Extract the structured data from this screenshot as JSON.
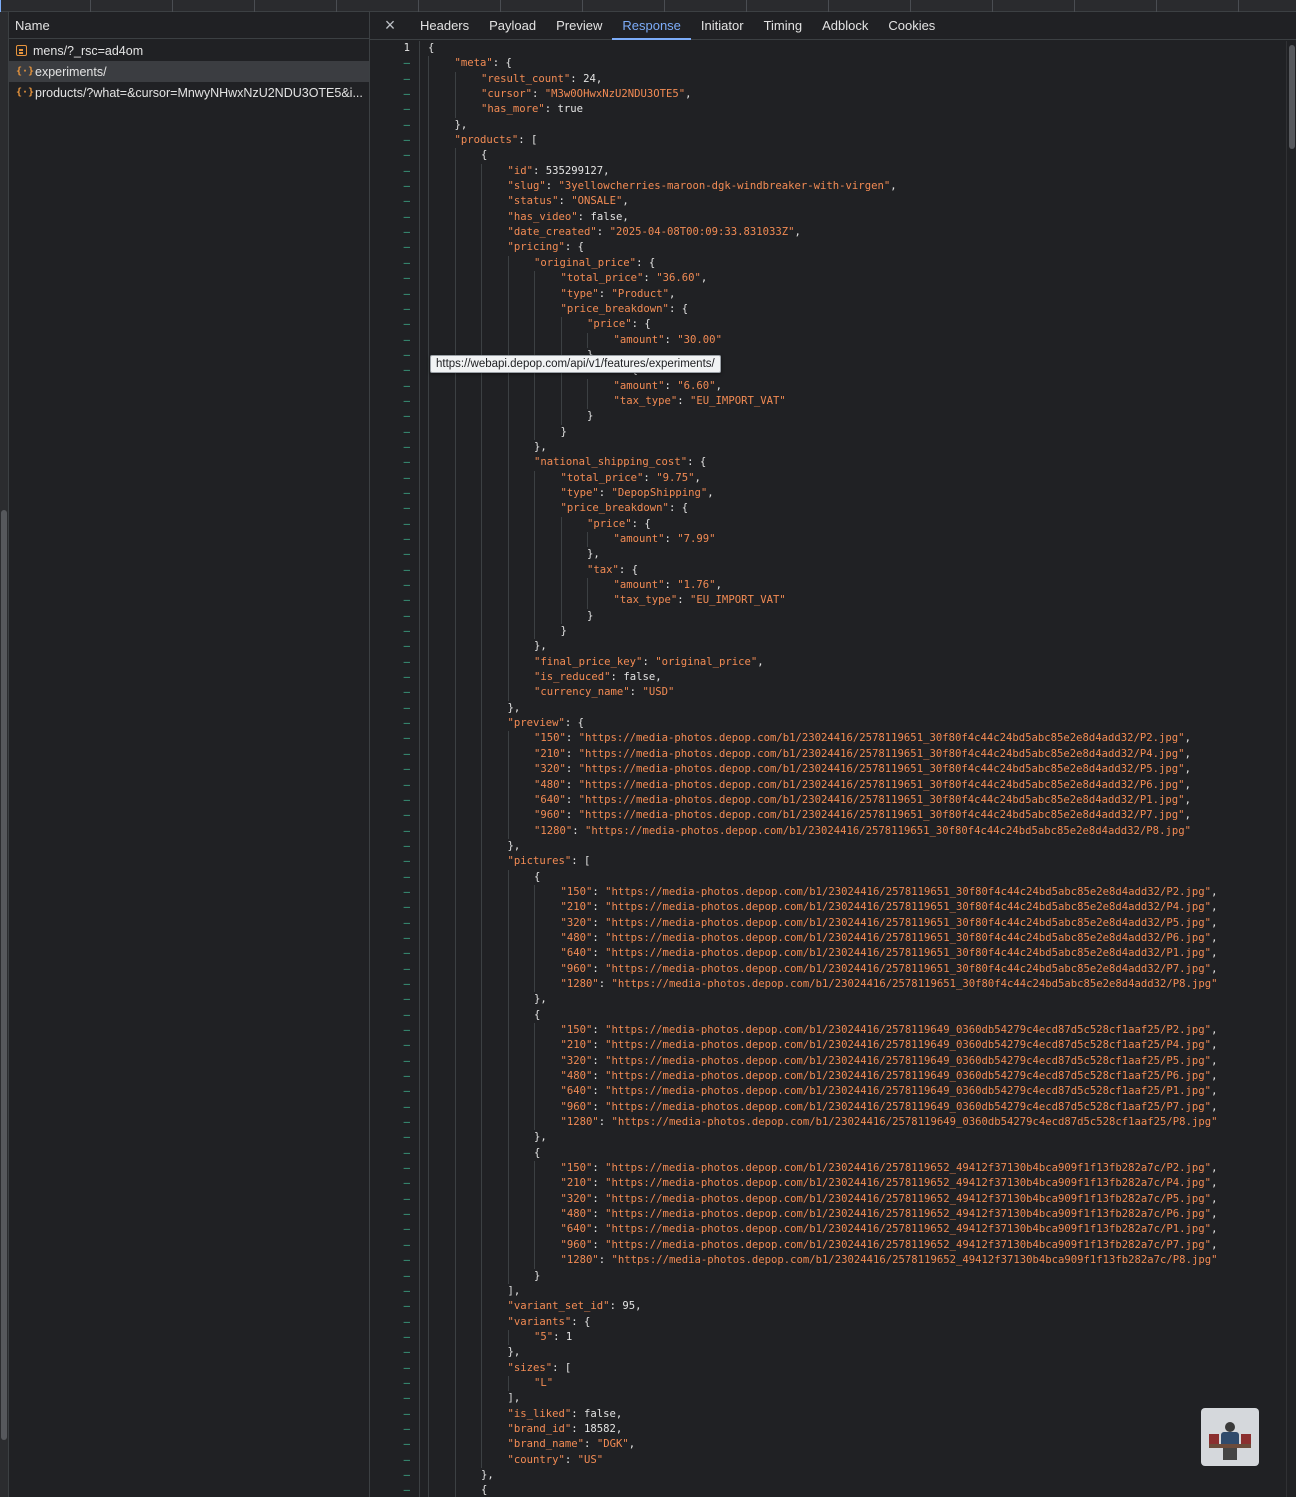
{
  "name_column": {
    "header": "Name"
  },
  "requests": [
    {
      "label": "mens/?_rsc=ad4om",
      "icon": "document-icon",
      "selected": false
    },
    {
      "label": "experiments/",
      "icon": "json-braces-icon",
      "selected": true
    },
    {
      "label": "products/?what=&cursor=MnwyNHwxNzU2NDU3OTE5&i...",
      "icon": "json-braces-icon",
      "selected": false
    }
  ],
  "tabs": [
    "Headers",
    "Payload",
    "Preview",
    "Response",
    "Initiator",
    "Timing",
    "Adblock",
    "Cookies"
  ],
  "active_tab": "Response",
  "close_icon": "×",
  "first_line_number": "1",
  "other_line_marker": "–",
  "tooltip": "https://webapi.depop.com/api/v1/features/experiments/",
  "colors": {
    "accent": "#7cacf8",
    "json_key": "#f28b54",
    "line_marker": "#3fb28e"
  },
  "response_lines": [
    "{",
    "    \"meta\": {",
    "        \"result_count\": 24,",
    "        \"cursor\": \"M3w0OHwxNzU2NDU3OTE5\",",
    "        \"has_more\": true",
    "    },",
    "    \"products\": [",
    "        {",
    "            \"id\": 535299127,",
    "            \"slug\": \"3yellowcherries-maroon-dgk-windbreaker-with-virgen\",",
    "            \"status\": \"ONSALE\",",
    "            \"has_video\": false,",
    "            \"date_created\": \"2025-04-08T00:09:33.831033Z\",",
    "            \"pricing\": {",
    "                \"original_price\": {",
    "                    \"total_price\": \"36.60\",",
    "                    \"type\": \"Product\",",
    "                    \"price_breakdown\": {",
    "                        \"price\": {",
    "                            \"amount\": \"30.00\"",
    "                        },",
    "                        \"tax\": {",
    "                            \"amount\": \"6.60\",",
    "                            \"tax_type\": \"EU_IMPORT_VAT\"",
    "                        }",
    "                    }",
    "                },",
    "                \"national_shipping_cost\": {",
    "                    \"total_price\": \"9.75\",",
    "                    \"type\": \"DepopShipping\",",
    "                    \"price_breakdown\": {",
    "                        \"price\": {",
    "                            \"amount\": \"7.99\"",
    "                        },",
    "                        \"tax\": {",
    "                            \"amount\": \"1.76\",",
    "                            \"tax_type\": \"EU_IMPORT_VAT\"",
    "                        }",
    "                    }",
    "                },",
    "                \"final_price_key\": \"original_price\",",
    "                \"is_reduced\": false,",
    "                \"currency_name\": \"USD\"",
    "            },",
    "            \"preview\": {",
    "                \"150\": \"https://media-photos.depop.com/b1/23024416/2578119651_30f80f4c44c24bd5abc85e2e8d4add32/P2.jpg\",",
    "                \"210\": \"https://media-photos.depop.com/b1/23024416/2578119651_30f80f4c44c24bd5abc85e2e8d4add32/P4.jpg\",",
    "                \"320\": \"https://media-photos.depop.com/b1/23024416/2578119651_30f80f4c44c24bd5abc85e2e8d4add32/P5.jpg\",",
    "                \"480\": \"https://media-photos.depop.com/b1/23024416/2578119651_30f80f4c44c24bd5abc85e2e8d4add32/P6.jpg\",",
    "                \"640\": \"https://media-photos.depop.com/b1/23024416/2578119651_30f80f4c44c24bd5abc85e2e8d4add32/P1.jpg\",",
    "                \"960\": \"https://media-photos.depop.com/b1/23024416/2578119651_30f80f4c44c24bd5abc85e2e8d4add32/P7.jpg\",",
    "                \"1280\": \"https://media-photos.depop.com/b1/23024416/2578119651_30f80f4c44c24bd5abc85e2e8d4add32/P8.jpg\"",
    "            },",
    "            \"pictures\": [",
    "                {",
    "                    \"150\": \"https://media-photos.depop.com/b1/23024416/2578119651_30f80f4c44c24bd5abc85e2e8d4add32/P2.jpg\",",
    "                    \"210\": \"https://media-photos.depop.com/b1/23024416/2578119651_30f80f4c44c24bd5abc85e2e8d4add32/P4.jpg\",",
    "                    \"320\": \"https://media-photos.depop.com/b1/23024416/2578119651_30f80f4c44c24bd5abc85e2e8d4add32/P5.jpg\",",
    "                    \"480\": \"https://media-photos.depop.com/b1/23024416/2578119651_30f80f4c44c24bd5abc85e2e8d4add32/P6.jpg\",",
    "                    \"640\": \"https://media-photos.depop.com/b1/23024416/2578119651_30f80f4c44c24bd5abc85e2e8d4add32/P1.jpg\",",
    "                    \"960\": \"https://media-photos.depop.com/b1/23024416/2578119651_30f80f4c44c24bd5abc85e2e8d4add32/P7.jpg\",",
    "                    \"1280\": \"https://media-photos.depop.com/b1/23024416/2578119651_30f80f4c44c24bd5abc85e2e8d4add32/P8.jpg\"",
    "                },",
    "                {",
    "                    \"150\": \"https://media-photos.depop.com/b1/23024416/2578119649_0360db54279c4ecd87d5c528cf1aaf25/P2.jpg\",",
    "                    \"210\": \"https://media-photos.depop.com/b1/23024416/2578119649_0360db54279c4ecd87d5c528cf1aaf25/P4.jpg\",",
    "                    \"320\": \"https://media-photos.depop.com/b1/23024416/2578119649_0360db54279c4ecd87d5c528cf1aaf25/P5.jpg\",",
    "                    \"480\": \"https://media-photos.depop.com/b1/23024416/2578119649_0360db54279c4ecd87d5c528cf1aaf25/P6.jpg\",",
    "                    \"640\": \"https://media-photos.depop.com/b1/23024416/2578119649_0360db54279c4ecd87d5c528cf1aaf25/P1.jpg\",",
    "                    \"960\": \"https://media-photos.depop.com/b1/23024416/2578119649_0360db54279c4ecd87d5c528cf1aaf25/P7.jpg\",",
    "                    \"1280\": \"https://media-photos.depop.com/b1/23024416/2578119649_0360db54279c4ecd87d5c528cf1aaf25/P8.jpg\"",
    "                },",
    "                {",
    "                    \"150\": \"https://media-photos.depop.com/b1/23024416/2578119652_49412f37130b4bca909f1f13fb282a7c/P2.jpg\",",
    "                    \"210\": \"https://media-photos.depop.com/b1/23024416/2578119652_49412f37130b4bca909f1f13fb282a7c/P4.jpg\",",
    "                    \"320\": \"https://media-photos.depop.com/b1/23024416/2578119652_49412f37130b4bca909f1f13fb282a7c/P5.jpg\",",
    "                    \"480\": \"https://media-photos.depop.com/b1/23024416/2578119652_49412f37130b4bca909f1f13fb282a7c/P6.jpg\",",
    "                    \"640\": \"https://media-photos.depop.com/b1/23024416/2578119652_49412f37130b4bca909f1f13fb282a7c/P1.jpg\",",
    "                    \"960\": \"https://media-photos.depop.com/b1/23024416/2578119652_49412f37130b4bca909f1f13fb282a7c/P7.jpg\",",
    "                    \"1280\": \"https://media-photos.depop.com/b1/23024416/2578119652_49412f37130b4bca909f1f13fb282a7c/P8.jpg\"",
    "                }",
    "            ],",
    "            \"variant_set_id\": 95,",
    "            \"variants\": {",
    "                \"5\": 1",
    "            },",
    "            \"sizes\": [",
    "                \"L\"",
    "            ],",
    "            \"is_liked\": false,",
    "            \"brand_id\": 18582,",
    "            \"brand_name\": \"DGK\",",
    "            \"country\": \"US\"",
    "        },",
    "        {"
  ]
}
